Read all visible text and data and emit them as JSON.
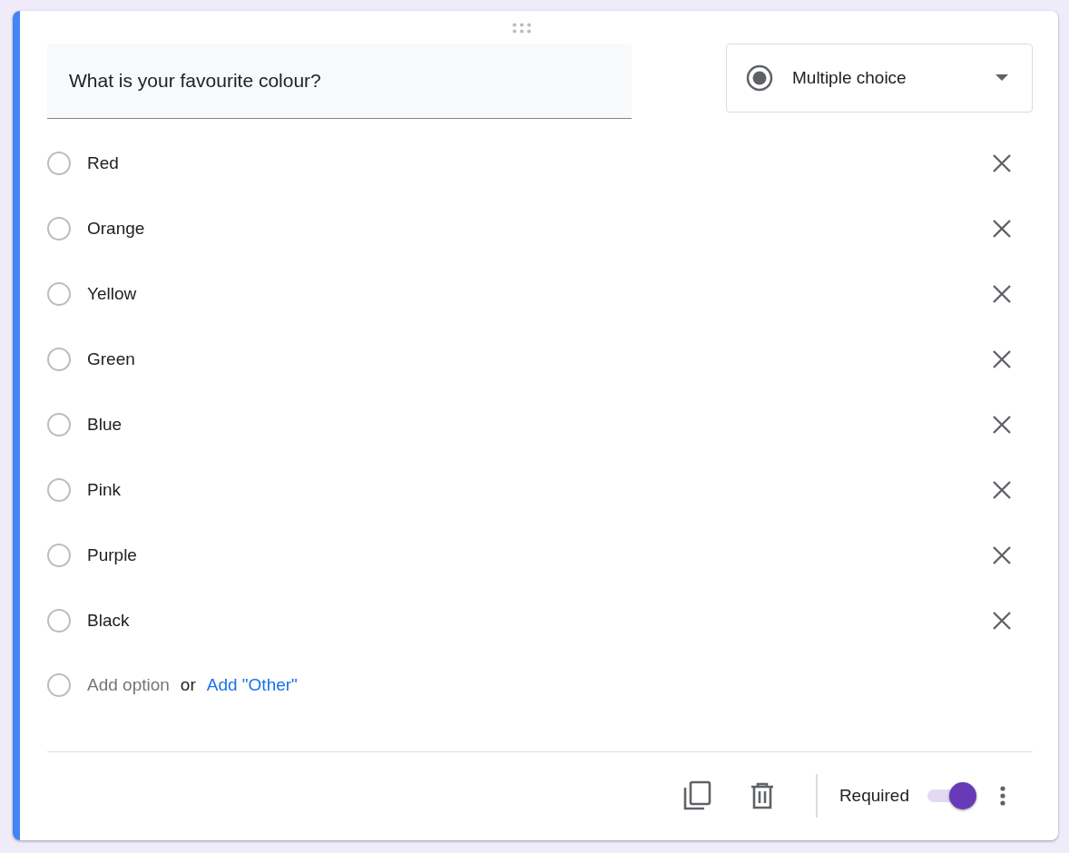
{
  "question": {
    "text": "What is your favourite colour?"
  },
  "question_type": {
    "label": "Multiple choice"
  },
  "options": [
    {
      "label": "Red"
    },
    {
      "label": "Orange"
    },
    {
      "label": "Yellow"
    },
    {
      "label": "Green"
    },
    {
      "label": "Blue"
    },
    {
      "label": "Pink"
    },
    {
      "label": "Purple"
    },
    {
      "label": "Black"
    }
  ],
  "add_option": {
    "label": "Add option",
    "connector": "or",
    "other_link": "Add \"Other\""
  },
  "footer": {
    "required_label": "Required",
    "required_on": true
  }
}
